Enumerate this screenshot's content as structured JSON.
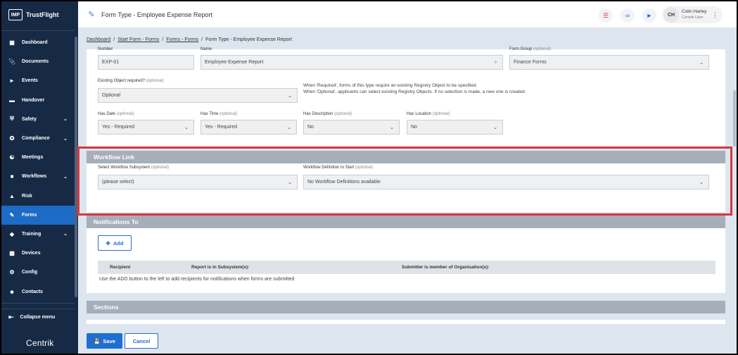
{
  "app": {
    "logo": "IMP",
    "name": "TrustFlight",
    "footer_brand": "Centrik"
  },
  "header": {
    "title": "Form Type",
    "subtitle": "Employee Expense Report",
    "user": {
      "initials": "CH",
      "name": "Colin Harley",
      "role": "Centrik User"
    }
  },
  "sidebar": {
    "items": [
      {
        "label": "Dashboard",
        "icon": "dashboard-icon",
        "chevron": false
      },
      {
        "label": "Documents",
        "icon": "paperclip-icon",
        "chevron": false
      },
      {
        "label": "Events",
        "icon": "megaphone-icon",
        "chevron": false
      },
      {
        "label": "Handover",
        "icon": "handover-icon",
        "chevron": false
      },
      {
        "label": "Safety",
        "icon": "shield-icon",
        "chevron": true
      },
      {
        "label": "Compliance",
        "icon": "compliance-icon",
        "chevron": true
      },
      {
        "label": "Meetings",
        "icon": "meetings-icon",
        "chevron": false
      },
      {
        "label": "Workflows",
        "icon": "workflow-icon",
        "chevron": true
      },
      {
        "label": "Risk",
        "icon": "warning-icon",
        "chevron": false
      },
      {
        "label": "Forms",
        "icon": "forms-icon",
        "chevron": false,
        "active": true
      },
      {
        "label": "Training",
        "icon": "graduation-cap-icon",
        "chevron": true
      },
      {
        "label": "Devices",
        "icon": "devices-icon",
        "chevron": false
      },
      {
        "label": "Config",
        "icon": "config-icon",
        "chevron": false
      },
      {
        "label": "Contacts",
        "icon": "contacts-icon",
        "chevron": false
      }
    ],
    "collapse_label": "Collapse menu"
  },
  "breadcrumb": {
    "items": [
      "Dashboard",
      "Start Form - Forms",
      "Forms - Forms"
    ],
    "current": "Form Type - Employee Expense Report"
  },
  "form": {
    "number_label": "Number",
    "number_value": "EXP-01",
    "name_label": "Name",
    "name_value": "Employee Expense Report",
    "group_label": "Form Group",
    "group_value": "Finance Forms",
    "optional": "(optional)",
    "existing_label": "Existing Object required?",
    "existing_value": "Optional",
    "existing_note_1": "When 'Required', forms of this type require an existing Registry Object to be specified.",
    "existing_note_2": "When 'Optional', applicants can select existing Registry Objects. If no selection is made, a new one is created.",
    "has_date_label": "Has Date",
    "has_date_value": "Yes - Required",
    "has_time_label": "Has Time",
    "has_time_value": "Yes - Required",
    "has_desc_label": "Has Description",
    "has_desc_value": "No",
    "has_loc_label": "Has Location",
    "has_loc_value": "No"
  },
  "workflow": {
    "heading": "Workflow Link",
    "subsystem_label": "Select Workflow Subsystem",
    "subsystem_value": "(please select)",
    "definition_label": "Workflow Definition to Start",
    "definition_value": "No Workflow Definitions available"
  },
  "notifications": {
    "heading": "Notifications To",
    "add_label": "Add",
    "columns": [
      "Recipient",
      "Report is in Subsystem(s):",
      "Submitter is member of Organisation(s):"
    ],
    "empty_text": "Use the ADD button to the left to add recipients for notifications when forms are submitted"
  },
  "sections": {
    "heading": "Sections"
  },
  "footer": {
    "save_label": "Save",
    "cancel_label": "Cancel"
  },
  "colors": {
    "sidebar_bg": "#172a45",
    "active": "#1c6bc4",
    "primary": "#1f6fd1",
    "highlight": "#d9363e"
  }
}
